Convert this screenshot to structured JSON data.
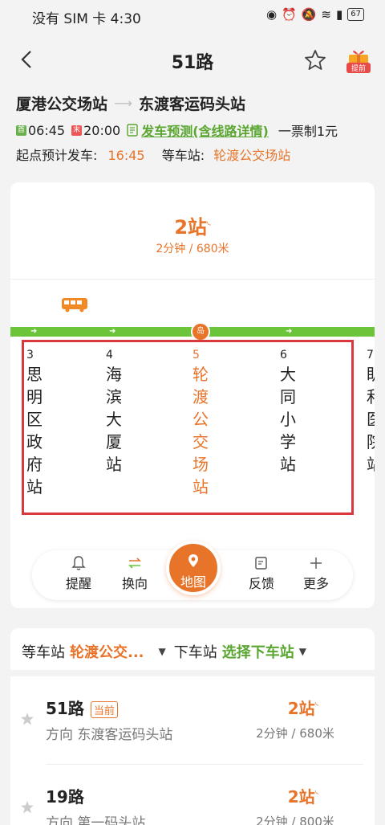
{
  "status_bar": {
    "left_text": "没有 SIM 卡 4:30",
    "battery": "67"
  },
  "nav": {
    "title": "51路",
    "gift_label": "提前"
  },
  "route": {
    "from": "厦港公交场站",
    "to": "东渡客运码头站",
    "first_tag": "首",
    "first_time": "06:45",
    "last_tag": "末",
    "last_time": "20:00",
    "forecast_link": "发车预测(含线路详情)",
    "ticket": "一票制1元",
    "depart_label": "起点预计发车:",
    "depart_time": "16:45",
    "wait_label": "等车站:",
    "wait_station": "轮渡公交场站"
  },
  "eta": {
    "stops": "2站",
    "detail": "2分钟 / 680米"
  },
  "marker_label": "岛",
  "stations": [
    {
      "num": "3",
      "name": "思明区政府站"
    },
    {
      "num": "4",
      "name": "海滨大厦站"
    },
    {
      "num": "5",
      "name": "轮渡公交场站"
    },
    {
      "num": "6",
      "name": "大同小学站"
    },
    {
      "num": "7",
      "name": "眀和医院站"
    }
  ],
  "actions": {
    "remind": "提醒",
    "reverse": "换向",
    "map": "地图",
    "feedback": "反馈",
    "more": "更多"
  },
  "selector": {
    "wait_label": "等车站",
    "wait_value": "轮渡公交...",
    "alight_label": "下车站",
    "alight_value": "选择下车站"
  },
  "lines": [
    {
      "name": "51路",
      "badge": "当前",
      "direction": "方向 东渡客运码头站",
      "eta": "2站",
      "detail": "2分钟 / 680米"
    },
    {
      "name": "19路",
      "badge": "",
      "direction": "方向 第一码头站",
      "eta": "2站",
      "detail": "2分钟 / 800米"
    }
  ]
}
